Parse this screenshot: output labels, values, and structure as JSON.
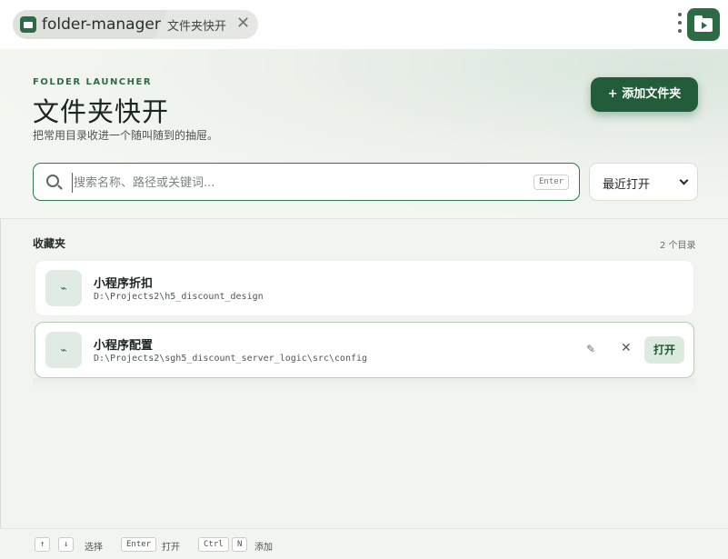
{
  "tabs": {
    "app_title": "folder-manager",
    "sub_tab_label": "文件夹快开",
    "close_glyph": "✕"
  },
  "hero": {
    "eyebrow": "FOLDER LAUNCHER",
    "title": "文件夹快开",
    "subtitle": "把常用目录收进一个随叫随到的抽屉。",
    "add_button_label": "+  添加文件夹"
  },
  "search": {
    "placeholder": "搜索名称、路径或关键词...",
    "value": "",
    "enter_hint": "Enter"
  },
  "sort": {
    "selected": "最近打开"
  },
  "favorites": {
    "title": "收藏夹",
    "count_label": "2 个目录",
    "items": [
      {
        "name": "小程序折扣",
        "path": "D:\\Projects2\\h5_discount_design",
        "icon_glyph": "⌁"
      },
      {
        "name": "小程序配置",
        "path": "D:\\Projects2\\sgh5_discount_server_logic\\src\\config",
        "icon_glyph": "⌁",
        "edit_glyph": "✎",
        "remove_glyph": "✕",
        "open_label": "打开"
      }
    ]
  },
  "footer": {
    "up_key": "↑",
    "down_key": "↓",
    "select_label": "选择",
    "enter_key": "Enter",
    "open_label": "打开",
    "ctrl_key": "Ctrl",
    "n_key": "N",
    "add_label": "添加"
  },
  "colors": {
    "accent": "#235c3a",
    "accent_light": "#dcebe0",
    "background": "#f2f4ef"
  }
}
